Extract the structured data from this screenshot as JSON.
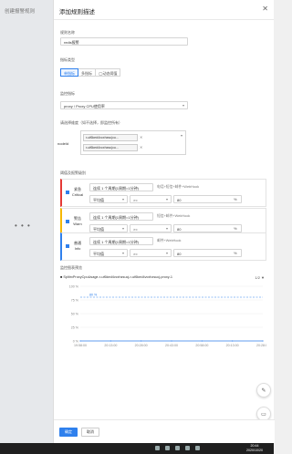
{
  "background": {
    "title": "创建报警规则",
    "more_label": "• • •"
  },
  "header": {
    "title": "添加规则描述",
    "close_label": "✕"
  },
  "rule_name": {
    "label": "规则名称",
    "value": "redis报警"
  },
  "metric_type": {
    "label": "指标类型",
    "options": [
      "单指标",
      "多指标",
      "动态阈值"
    ],
    "selected": "单指标"
  },
  "monitor_metric": {
    "label": "监控指标",
    "value": "proxy / Proxy CPU使用率",
    "arrow": "▾"
  },
  "dimension": {
    "label": "请选择维度（如不选择，即监控所有）",
    "key_label": "nodeId",
    "tags": [
      "r-uf6ked... (id truncated)",
      "r-uf6ked... (id truncated)"
    ],
    "tag_texts": [
      "r-uf6ked4vcxhzsu|cu...",
      "r-uf6ked4vcxhzsu|cu..."
    ],
    "remove_icon": "✕",
    "caret": "▾"
  },
  "thresholds": {
    "label": "阈值及报警级别",
    "levels": [
      {
        "name": "紧急",
        "name_en": "Critical",
        "period": "连续 1 个周期(1周期=1分钟)",
        "channels": "电话+短信+邮件+WebHook",
        "aggregation": "平均值",
        "operator": ">=",
        "value": "80",
        "unit": "%"
      },
      {
        "name": "警告",
        "name_en": "Warn",
        "period": "连续 1 个周期(1周期=1分钟)",
        "channels": "短信+邮件+WebHook",
        "aggregation": "平均值",
        "operator": ">=",
        "value": "80",
        "unit": "%"
      },
      {
        "name": "普通",
        "name_en": "Info",
        "period": "连续 1 个周期(1周期=1分钟)",
        "channels": "邮件+WebHook",
        "aggregation": "平均值",
        "operator": ">=",
        "value": "80",
        "unit": "%"
      }
    ]
  },
  "preview": {
    "label": "监控图表预览",
    "series_title": "■ SplitrxProxyCpuUsage-r-uf6ked4vcxhzsucj-r-uf6ked4vcxhzsucj-proxy-1",
    "pager": "1/2 ▼"
  },
  "chart_data": {
    "type": "line",
    "x": [
      "19:58:00",
      "20:13:00",
      "20:28:00",
      "20:43:00",
      "20:58:00",
      "20:13:00",
      "20:28:00"
    ],
    "ytick_labels": [
      "100 %",
      "75 %",
      "50 %",
      "25 %",
      "0 %"
    ],
    "ylim": [
      0,
      100
    ],
    "series": [
      {
        "name": "SplitrxProxyCpuUsage-r-uf6ked4vcxhzsucj-r-uf6ked4vcxhzsucj-proxy-1",
        "values": [
          0,
          0,
          0,
          0,
          0,
          0,
          0
        ]
      }
    ],
    "threshold": 80,
    "threshold_label": "80 %",
    "colors": {
      "line": "#2f80ed",
      "threshold": "#2f80ed"
    }
  },
  "footer": {
    "confirm_label": "确定",
    "cancel_label": "取消"
  },
  "floating": {
    "edit_icon": "✎",
    "chat_icon": "▭"
  },
  "taskbar": {
    "time": "20:44",
    "date": "2020/10/20"
  },
  "colors": {
    "primary": "#2f80ed",
    "critical": "#e53935",
    "warn": "#f5b700",
    "info": "#2f80ed"
  }
}
